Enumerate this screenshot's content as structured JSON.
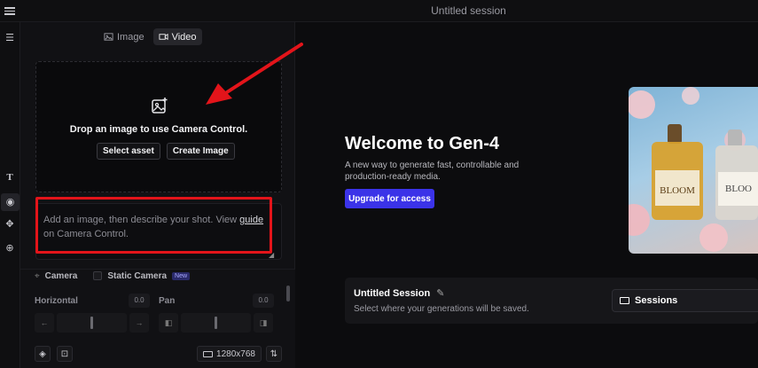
{
  "header": {
    "title": "Untitled session"
  },
  "tabs": [
    {
      "label": "Image",
      "icon": "image-icon",
      "active": false
    },
    {
      "label": "Video",
      "icon": "video-icon",
      "active": true
    }
  ],
  "dropzone": {
    "text": "Drop an image to use Camera Control.",
    "select_label": "Select asset",
    "create_label": "Create Image"
  },
  "prompt": {
    "text_before": "Add an image, then describe your shot. View ",
    "link": "guide",
    "text_after": " on Camera Control."
  },
  "camera": {
    "camera_label": "Camera",
    "static_label": "Static Camera",
    "new_badge": "New",
    "horizontal_label": "Horizontal",
    "horizontal_value": "0.0",
    "horizontal_level": 0.5,
    "pan_label": "Pan",
    "pan_value": "0.0",
    "pan_level": 0.5
  },
  "footer": {
    "resolution": "1280x768"
  },
  "main": {
    "welcome": "Welcome to Gen-4",
    "subtitle": "A new way to generate fast, controllable and production-ready media.",
    "upgrade_label": "Upgrade for access",
    "hero_text_1": "BLOOM",
    "hero_text_2": "BLOO"
  },
  "session": {
    "title": "Untitled Session",
    "subtitle": "Select where your generations will be saved.",
    "sessions_label": "Sessions"
  },
  "colors": {
    "accent": "#3b33e8",
    "highlight": "#e3141a",
    "background": "#0c0c0e"
  }
}
